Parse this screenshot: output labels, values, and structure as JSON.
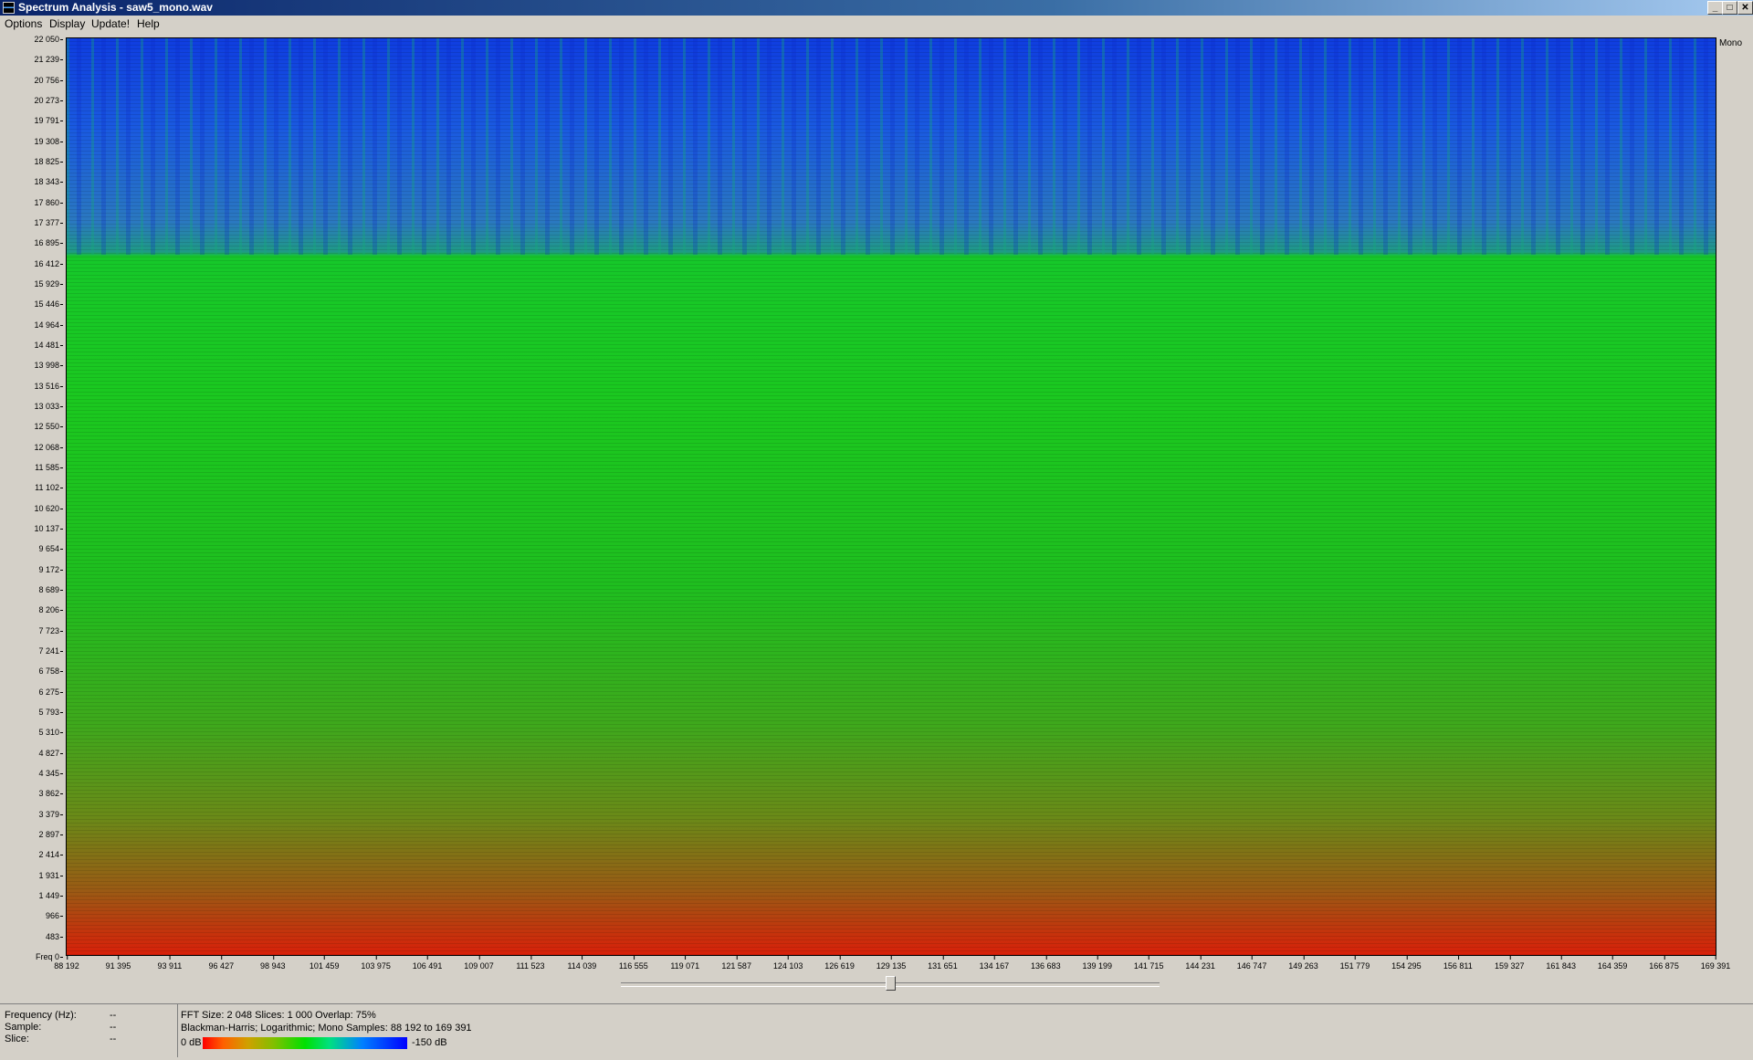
{
  "window": {
    "title": "Spectrum Analysis - saw5_mono.wav",
    "controls": {
      "minimize": "_",
      "maximize": "□",
      "close": "✕"
    }
  },
  "menu": [
    "Options",
    "Display",
    "Update!",
    "Help"
  ],
  "channel_label": "Mono",
  "y_axis": {
    "ticks": [
      "22 050",
      "21 239",
      "20 756",
      "20 273",
      "19 791",
      "19 308",
      "18 825",
      "18 343",
      "17 860",
      "17 377",
      "16 895",
      "16 412",
      "15 929",
      "15 446",
      "14 964",
      "14 481",
      "13 998",
      "13 516",
      "13 033",
      "12 550",
      "12 068",
      "11 585",
      "11 102",
      "10 620",
      "10 137",
      "9 654",
      "9 172",
      "8 689",
      "8 206",
      "7 723",
      "7 241",
      "6 758",
      "6 275",
      "5 793",
      "5 310",
      "4 827",
      "4 345",
      "3 862",
      "3 379",
      "2 897",
      "2 414",
      "1 931",
      "1 449",
      "966",
      "483",
      "Freq 0"
    ]
  },
  "x_axis": {
    "ticks": [
      "88 192",
      "91 395",
      "93 911",
      "96 427",
      "98 943",
      "101 459",
      "103 975",
      "106 491",
      "109 007",
      "111 523",
      "114 039",
      "116 555",
      "119 071",
      "121 587",
      "124 103",
      "126 619",
      "129 135",
      "131 651",
      "134 167",
      "136 683",
      "139 199",
      "141 715",
      "144 231",
      "146 747",
      "149 263",
      "151 779",
      "154 295",
      "156 811",
      "159 327",
      "161 843",
      "164 359",
      "166 875",
      "169 391"
    ]
  },
  "slider": {
    "position_fraction": 0.5
  },
  "status": {
    "frequency_label": "Frequency (Hz):",
    "frequency_value": "--",
    "sample_label": "Sample:",
    "sample_value": "--",
    "slice_label": "Slice:",
    "slice_value": "--",
    "fft_info": "FFT Size: 2 048  Slices: 1 000  Overlap: 75%",
    "window_info": "Blackman-Harris; Logarithmic; Mono  Samples: 88 192 to 169 391",
    "db_max": "0 dB",
    "db_min": "-150 dB"
  }
}
